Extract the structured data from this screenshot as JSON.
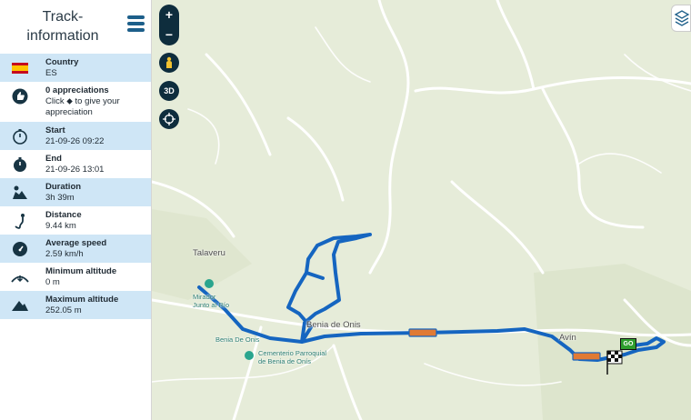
{
  "sidebar": {
    "title": "Track-\ninformation",
    "rows": [
      {
        "label": "Country",
        "value": "ES",
        "icon": "spain-flag-icon",
        "highlight": true
      },
      {
        "label": "0 appreciations",
        "value": "Click ⬥ to give your appreciation",
        "icon": "thumbs-up-icon",
        "highlight": false
      },
      {
        "label": "Start",
        "value": "21-09-26 09:22",
        "icon": "stopwatch-start-icon",
        "highlight": true
      },
      {
        "label": "End",
        "value": "21-09-26 13:01",
        "icon": "stopwatch-end-icon",
        "highlight": false
      },
      {
        "label": "Duration",
        "value": "3h 39m",
        "icon": "duration-icon",
        "highlight": true
      },
      {
        "label": "Distance",
        "value": "9.44 km",
        "icon": "distance-icon",
        "highlight": false
      },
      {
        "label": "Average speed",
        "value": "2.59 km/h",
        "icon": "speedometer-icon",
        "highlight": true
      },
      {
        "label": "Minimum altitude",
        "value": "0 m",
        "icon": "min-altitude-icon",
        "highlight": false
      },
      {
        "label": "Maximum altitude",
        "value": "252.05 m",
        "icon": "max-altitude-icon",
        "highlight": true
      }
    ]
  },
  "map": {
    "controls": {
      "zoom_in": "+",
      "zoom_out": "−",
      "three_d": "3D"
    },
    "places": {
      "talaveru": "Talaveru",
      "mirador": "Mirador\nJunto al Río",
      "benia_de_onis": "Benia De Onis",
      "benia_de_onis_center": "Benia de Onis",
      "cementerio": "Cementerio Parroquial\nde Benia de Onís",
      "avin": "Avín",
      "go": "GO"
    },
    "colors": {
      "track": "#1565c0",
      "road": "#ffffff",
      "land": "#e6ecd9"
    }
  }
}
